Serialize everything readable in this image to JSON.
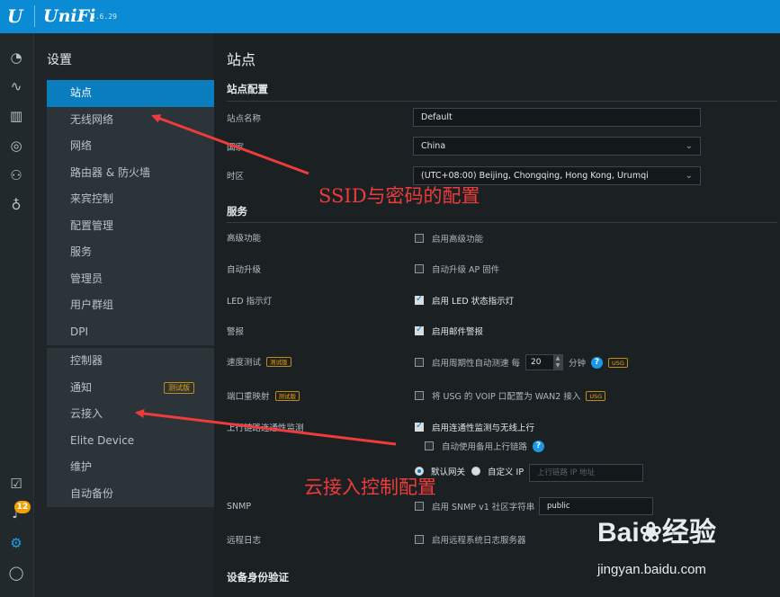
{
  "topbar": {
    "brand": "UniFi",
    "version": "5.6.29",
    "logo": "U"
  },
  "rail": {
    "icons": [
      "dashboard-icon",
      "statistics-icon",
      "map-icon",
      "devices-icon",
      "clients-icon",
      "insights-icon"
    ],
    "bottom_icons": [
      "tasks-icon",
      "alerts-icon",
      "settings-icon",
      "chat-icon"
    ],
    "alerts_badge": "12"
  },
  "nav": {
    "title": "设置",
    "group1": [
      "站点",
      "无线网络",
      "网络",
      "路由器 & 防火墙",
      "来宾控制",
      "配置管理",
      "服务",
      "管理员",
      "用户群组",
      "DPI"
    ],
    "group2": [
      "控制器",
      "通知",
      "云接入",
      "Elite Device",
      "维护",
      "自动备份"
    ],
    "beta_tag": "测试版"
  },
  "main": {
    "page_title": "站点",
    "site_config": {
      "title": "站点配置",
      "name_label": "站点名称",
      "name_value": "Default",
      "country_label": "国家",
      "country_value": "China",
      "timezone_label": "时区",
      "timezone_value": "(UTC+08:00) Beijing, Chongqing, Hong Kong, Urumqi"
    },
    "services": {
      "title": "服务",
      "advanced_label": "高级功能",
      "advanced_check": "启用高级功能",
      "autoupgrade_label": "自动升级",
      "autoupgrade_check": "自动升级 AP 固件",
      "led_label": "LED 指示灯",
      "led_check": "启用 LED 状态指示灯",
      "alert_label": "警报",
      "alert_check": "启用邮件警报",
      "speedtest_label": "速度测试",
      "speedtest_tag": "测试版",
      "speedtest_check": "启用周期性自动测速 每",
      "speedtest_value": "20",
      "speedtest_unit": "分钟",
      "usg_tag": "USG",
      "portmap_label": "端口重映射",
      "portmap_tag": "测试版",
      "portmap_check": "将 USG 的 VOIP 口配置为 WAN2 接入",
      "monitor_label": "上行链路连通性监测",
      "monitor_check": "启用连通性监测与无线上行",
      "backup_uplink_check": "自动使用备用上行链路",
      "default_gateway": "默认网关",
      "custom_ip": "自定义 IP",
      "uplink_ip_placeholder": "上行链路 IP 地址",
      "snmp_label": "SNMP",
      "snmp_check": "启用 SNMP v1 社区字符串",
      "snmp_value": "public",
      "syslog_label": "远程日志",
      "syslog_check": "启用远程系统日志服务器"
    },
    "device_auth_title": "设备身份验证"
  },
  "annotations": {
    "ssid": "SSID与密码的配置",
    "cloud": "云接入控制配置",
    "color": "#ee3b3b"
  },
  "watermark": {
    "brand": "Bai",
    "brand_cn": "经验",
    "url": "jingyan.baidu.com"
  }
}
